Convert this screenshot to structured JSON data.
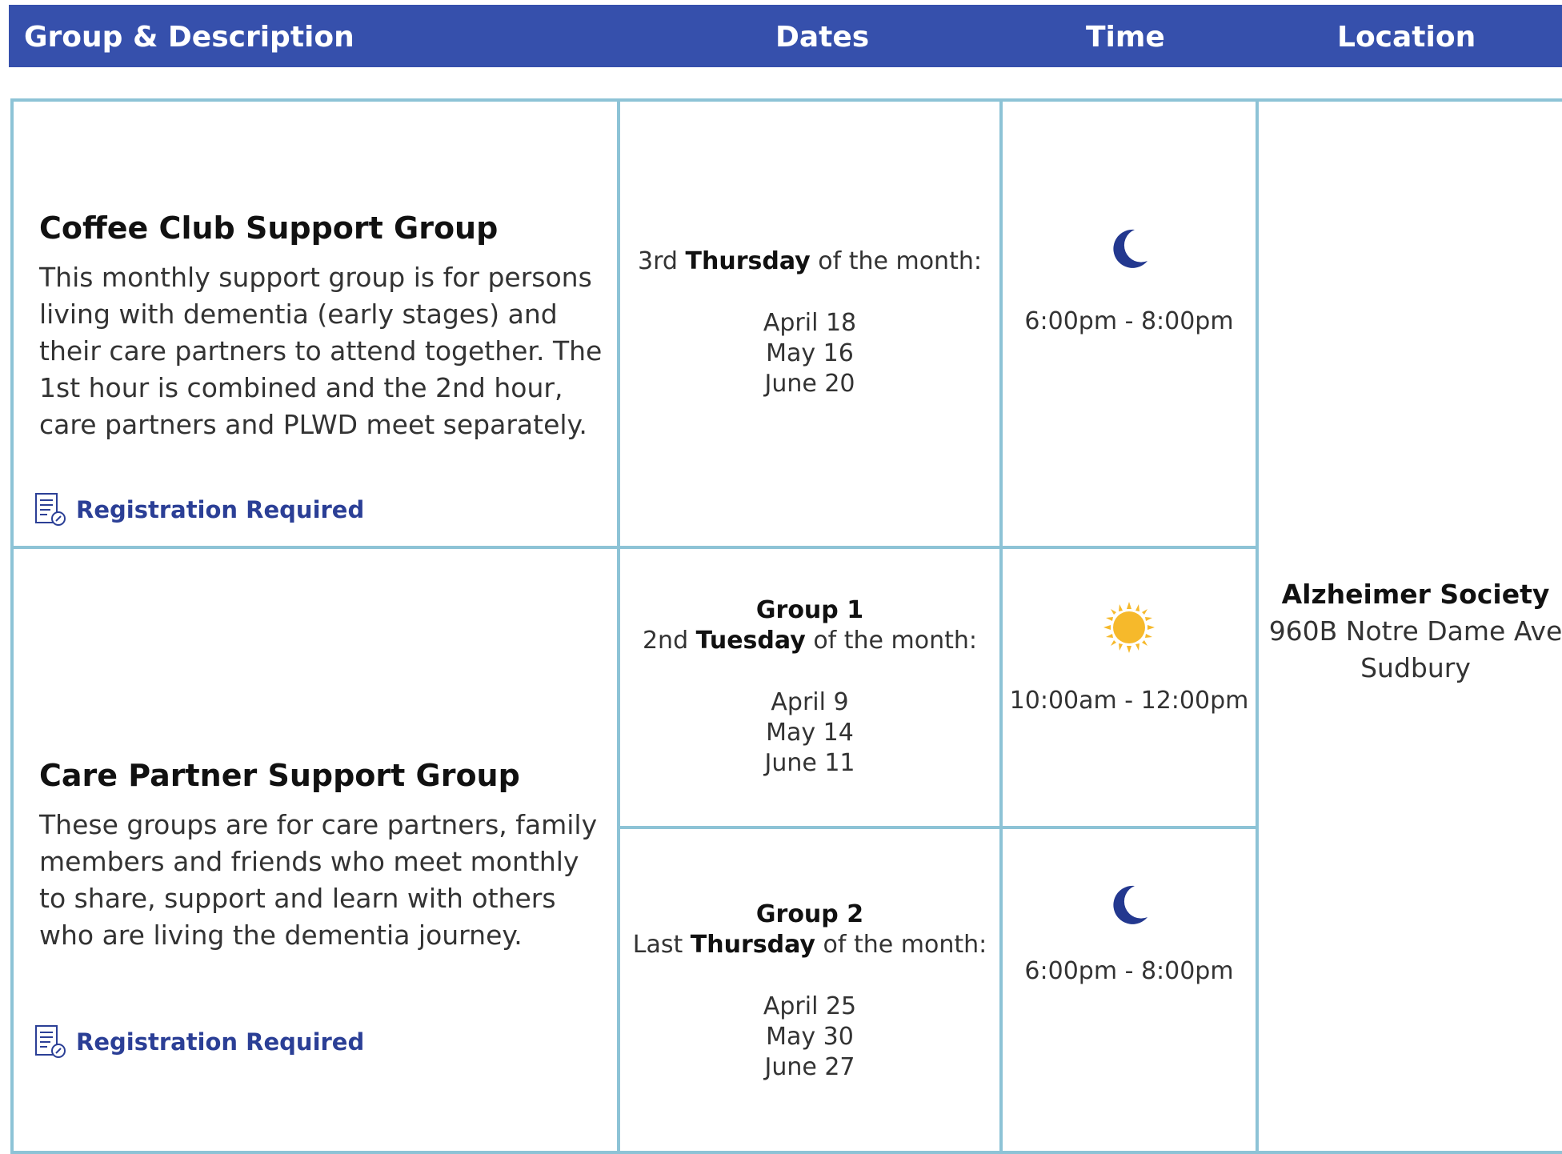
{
  "header": {
    "group_desc": "Group & Description",
    "dates": "Dates",
    "time": "Time",
    "location": "Location"
  },
  "groups": [
    {
      "title": "Coffee Club Support Group",
      "description": "This monthly support group is for persons living with dementia (early stages) and their care partners to attend together. The 1st hour is combined and the 2nd hour, care partners and PLWD meet separately.",
      "registration": "Registration Required",
      "schedule": {
        "prefix": "3rd",
        "day": "Thursday",
        "suffix": "of the month:",
        "dates": [
          "April 18",
          "May 16",
          "June 20"
        ]
      },
      "time": {
        "icon": "moon-icon",
        "text": "6:00pm - 8:00pm"
      }
    },
    {
      "title": "Care Partner Support Group",
      "description": "These groups are for care partners, family members and friends who meet monthly to share, support and learn with others who are living the dementia journey.",
      "registration": "Registration Required",
      "subgroups": [
        {
          "name": "Group 1",
          "prefix": "2nd",
          "day": "Tuesday",
          "suffix": "of the month:",
          "dates": [
            "April 9",
            "May 14",
            "June 11"
          ],
          "time": {
            "icon": "sun-icon",
            "text": "10:00am - 12:00pm"
          }
        },
        {
          "name": "Group 2",
          "prefix": "Last",
          "day": "Thursday",
          "suffix": "of the month:",
          "dates": [
            "April 25",
            "May 30",
            "June 27"
          ],
          "time": {
            "icon": "moon-icon",
            "text": "6:00pm - 8:00pm"
          }
        }
      ]
    }
  ],
  "location": {
    "name": "Alzheimer Society",
    "address": "960B Notre Dame Ave",
    "city": "Sudbury"
  },
  "colors": {
    "header_bg": "#3650ac",
    "border": "#8dc3d6",
    "accent": "#2b3f96",
    "moon": "#23388f",
    "sun": "#f6b92b"
  }
}
